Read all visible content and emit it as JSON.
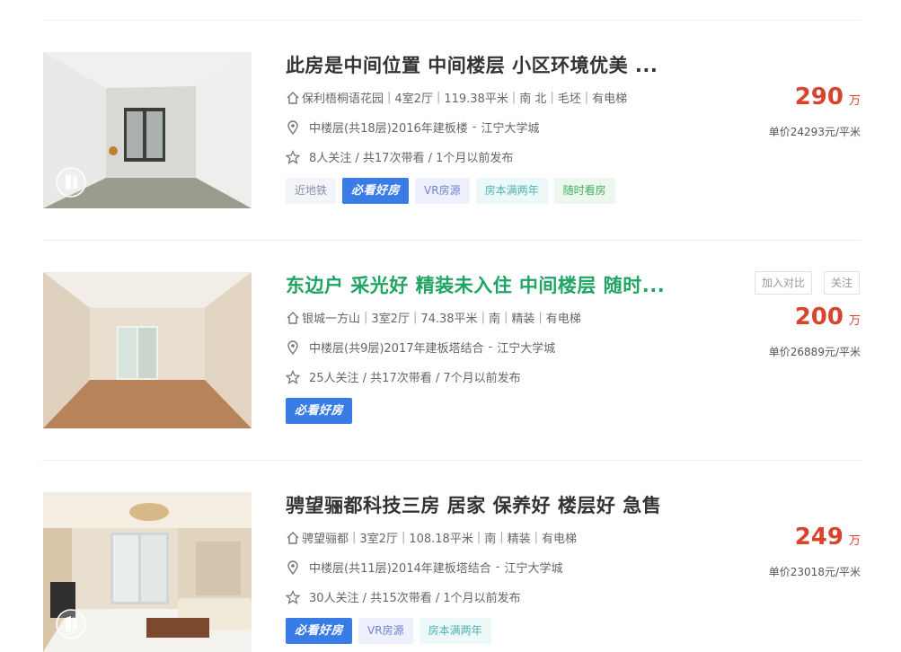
{
  "listings": [
    {
      "title": "此房是中间位置 中间楼层 小区环境优美 ...",
      "community": "保利梧桐语花园",
      "specs": [
        "4室2厅",
        "119.38平米",
        "南 北",
        "毛坯",
        "有电梯"
      ],
      "floor": "中楼层(共18层)2016年建板楼",
      "area": "江宁大学城",
      "follow": "8人关注 / 共17次带看 / 1个月以前发布",
      "tags": [
        "近地铁",
        "必看好房",
        "VR房源",
        "房本满两年",
        "随时看房"
      ],
      "price": "290",
      "price_unit": "万",
      "unit_price": "单价24293元/平米"
    },
    {
      "title": "东边户 采光好 精装未入住 中间楼层 随时...",
      "community": "银城一方山",
      "specs": [
        "3室2厅",
        "74.38平米",
        "南",
        "精装",
        "有电梯"
      ],
      "floor": "中楼层(共9层)2017年建板塔结合",
      "area": "江宁大学城",
      "follow": "25人关注 / 共17次带看 / 7个月以前发布",
      "tags": [
        "必看好房"
      ],
      "price": "200",
      "price_unit": "万",
      "unit_price": "单价26889元/平米",
      "compare_label": "加入对比",
      "favorite_label": "关注"
    },
    {
      "title": "骋望骊都科技三房 居家 保养好 楼层好 急售",
      "community": "骋望骊都",
      "specs": [
        "3室2厅",
        "108.18平米",
        "南",
        "精装",
        "有电梯"
      ],
      "floor": "中楼层(共11层)2014年建板塔结合",
      "area": "江宁大学城",
      "follow": "30人关注 / 共15次带看 / 1个月以前发布",
      "tags": [
        "必看好房",
        "VR房源",
        "房本满两年"
      ],
      "price": "249",
      "price_unit": "万",
      "unit_price": "单价23018元/平米"
    }
  ],
  "colors": {
    "price": "#d9442f",
    "highlight_title": "#1fa463",
    "bikan_tag": "#3a7ce6"
  },
  "icons": {
    "community": "house-icon",
    "location": "location-pin-icon",
    "follow": "star-icon",
    "vr": "vr-badge-icon"
  }
}
